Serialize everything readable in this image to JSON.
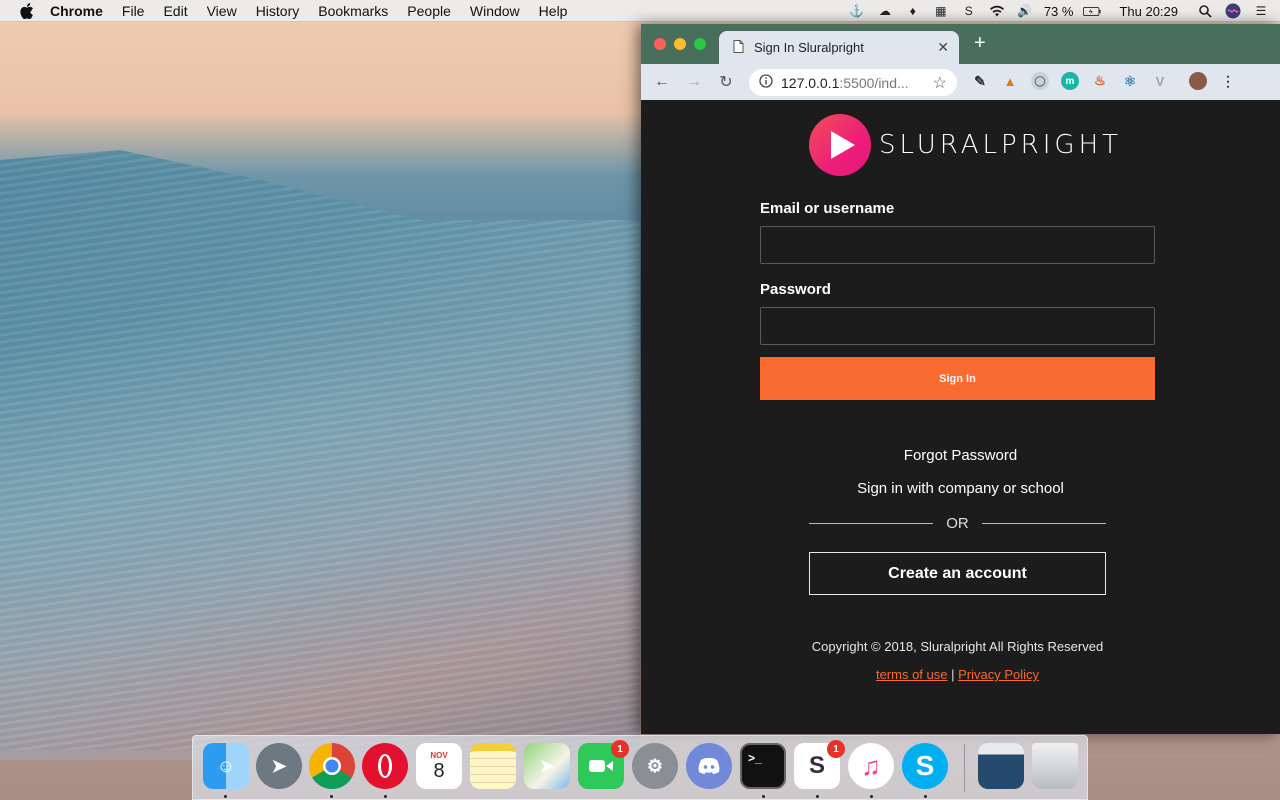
{
  "menubar": {
    "app_name": "Chrome",
    "items": [
      "File",
      "Edit",
      "View",
      "History",
      "Bookmarks",
      "People",
      "Window",
      "Help"
    ],
    "battery": "73 %",
    "clock": "Thu 20:29"
  },
  "browser": {
    "tab_title": "Sign In Sluralpright",
    "url_host": "127.0.0.1",
    "url_rest": ":5500/ind..."
  },
  "page": {
    "brand": "SLURALPRIGHT",
    "email_label": "Email or username",
    "email_value": "",
    "password_label": "Password",
    "password_value": "",
    "signin_label": "Sign In",
    "forgot_label": "Forgot Password",
    "company_label": "Sign in with company or school",
    "or_label": "OR",
    "create_label": "Create an account",
    "copyright": "Copyright © 2018, Sluralpright All Rights Reserved",
    "terms_label": "terms of use",
    "separator": "|",
    "privacy_label": "Privacy Policy"
  },
  "dock": {
    "calendar_month": "NOV",
    "calendar_day": "8",
    "facetime_badge": "1",
    "slack_badge": "1"
  },
  "colors": {
    "accent": "#f96b30",
    "page_bg": "#1c1c1c",
    "tabstrip": "#486f5c",
    "toolbar": "#dfe6ee"
  }
}
